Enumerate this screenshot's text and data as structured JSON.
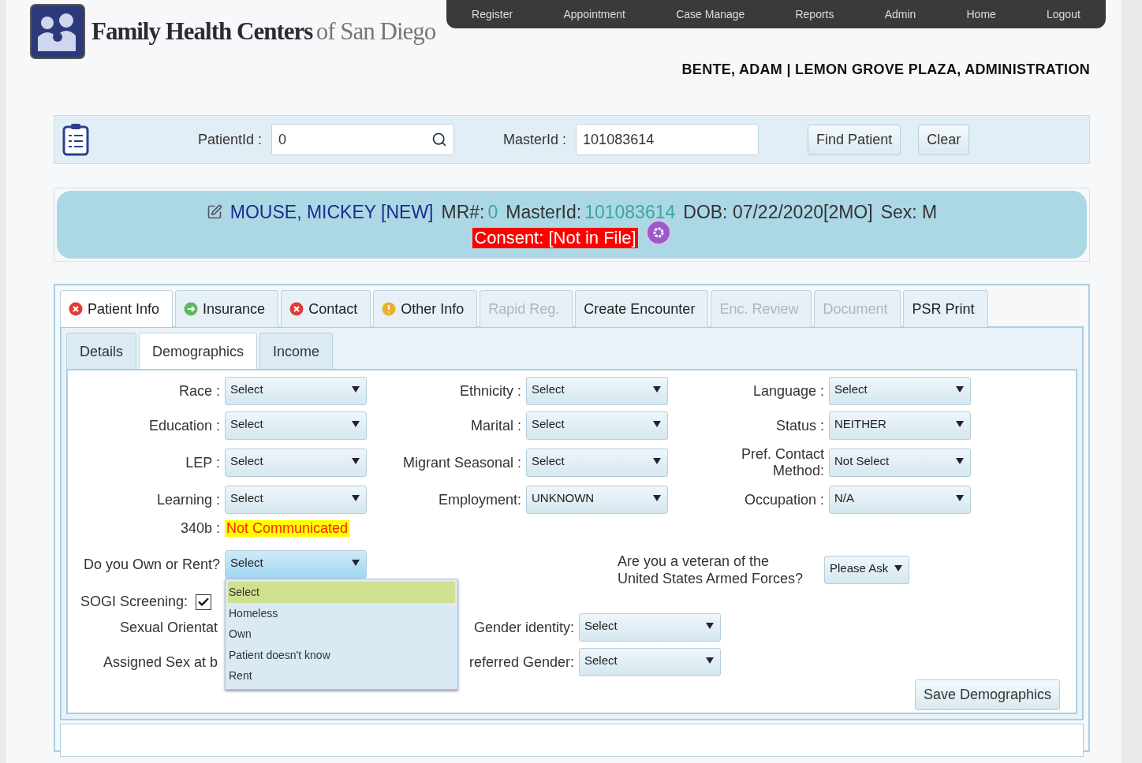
{
  "header": {
    "logo_main": "Family Health Centers",
    "logo_sub": "of San Diego",
    "nav": [
      "Register",
      "Appointment",
      "Case Manage",
      "Reports",
      "Admin",
      "Home",
      "Logout"
    ],
    "user": "BENTE, ADAM | LEMON GROVE PLAZA, ADMINISTRATION"
  },
  "search": {
    "patient_label": "PatientId :",
    "patient_value": "0",
    "master_label": "MasterId :",
    "master_value": "101083614",
    "buttons": [
      "Find Patient",
      "Clear"
    ]
  },
  "banner": {
    "name": "MOUSE, MICKEY [NEW]",
    "mr_label": "MR#:",
    "mr_value": "0",
    "master_label": "MasterId:",
    "master_value": "101083614",
    "dob": "DOB: 07/22/2020[2MO]",
    "sex": "Sex: M",
    "consent": "Consent: [Not in File]"
  },
  "tabs": [
    {
      "label": "Patient Info",
      "selected": true,
      "disabled": false,
      "kind": "error",
      "color": "#e53935"
    },
    {
      "label": "Insurance",
      "selected": false,
      "disabled": false,
      "kind": "ok",
      "color": "#5cb85c"
    },
    {
      "label": "Contact",
      "selected": false,
      "disabled": false,
      "kind": "error",
      "color": "#e53935"
    },
    {
      "label": "Other Info",
      "selected": false,
      "disabled": false,
      "kind": "warning",
      "color": "#f0ad2e"
    },
    {
      "label": "Rapid Reg.",
      "selected": false,
      "disabled": true
    },
    {
      "label": "Create Encounter",
      "selected": false,
      "disabled": false
    },
    {
      "label": "Enc. Review",
      "selected": false,
      "disabled": true
    },
    {
      "label": "Document",
      "selected": false,
      "disabled": true
    },
    {
      "label": "PSR Print",
      "selected": false,
      "disabled": false
    }
  ],
  "subtabs": [
    {
      "label": "Details",
      "selected": false
    },
    {
      "label": "Demographics",
      "selected": true
    },
    {
      "label": "Income",
      "selected": false
    }
  ],
  "fields": [
    [
      {
        "label": "Race :",
        "value": "Select"
      },
      {
        "label": "Ethnicity :",
        "value": "Select"
      },
      {
        "label": "Language :",
        "value": "Select"
      }
    ],
    [
      {
        "label": "Education :",
        "value": "Select"
      },
      {
        "label": "Marital :",
        "value": "Select"
      },
      {
        "label": "Status :",
        "value": "NEITHER"
      }
    ],
    [
      {
        "label": "LEP :",
        "value": "Select"
      },
      {
        "label": "Migrant Seasonal :",
        "value": "Select"
      },
      {
        "label": "Pref. Contact Method:",
        "value": "Not Select"
      }
    ],
    [
      {
        "label": "Learning :",
        "value": "Select"
      },
      {
        "label": "Employment:",
        "value": "UNKNOWN"
      },
      {
        "label": "Occupation :",
        "value": "N/A"
      }
    ]
  ],
  "b340": {
    "label": "340b :",
    "value": "Not Communicated"
  },
  "own_rent": {
    "label": "Do you Own or Rent?",
    "value": "Select",
    "expanded": true,
    "options": [
      {
        "label": "Select",
        "selected": true
      },
      {
        "label": "Homeless",
        "selected": false
      },
      {
        "label": "Own",
        "selected": false
      },
      {
        "label": "Patient doesn't know",
        "selected": false
      },
      {
        "label": "Rent",
        "selected": false
      }
    ]
  },
  "veteran": {
    "label": "Are you a veteran of the United States Armed Forces?",
    "value": "Please Ask"
  },
  "sogi": {
    "label": "SOGI Screening:",
    "checked": true
  },
  "sexual_orientation_label": "Sexual Orientat",
  "assigned_sex_label": "Assigned Sex at b",
  "gender_identity": {
    "label": "Gender identity:",
    "value": "Select"
  },
  "preferred_gender": {
    "label": "referred Gender:",
    "value": "Select"
  },
  "save_button": "Save Demographics"
}
